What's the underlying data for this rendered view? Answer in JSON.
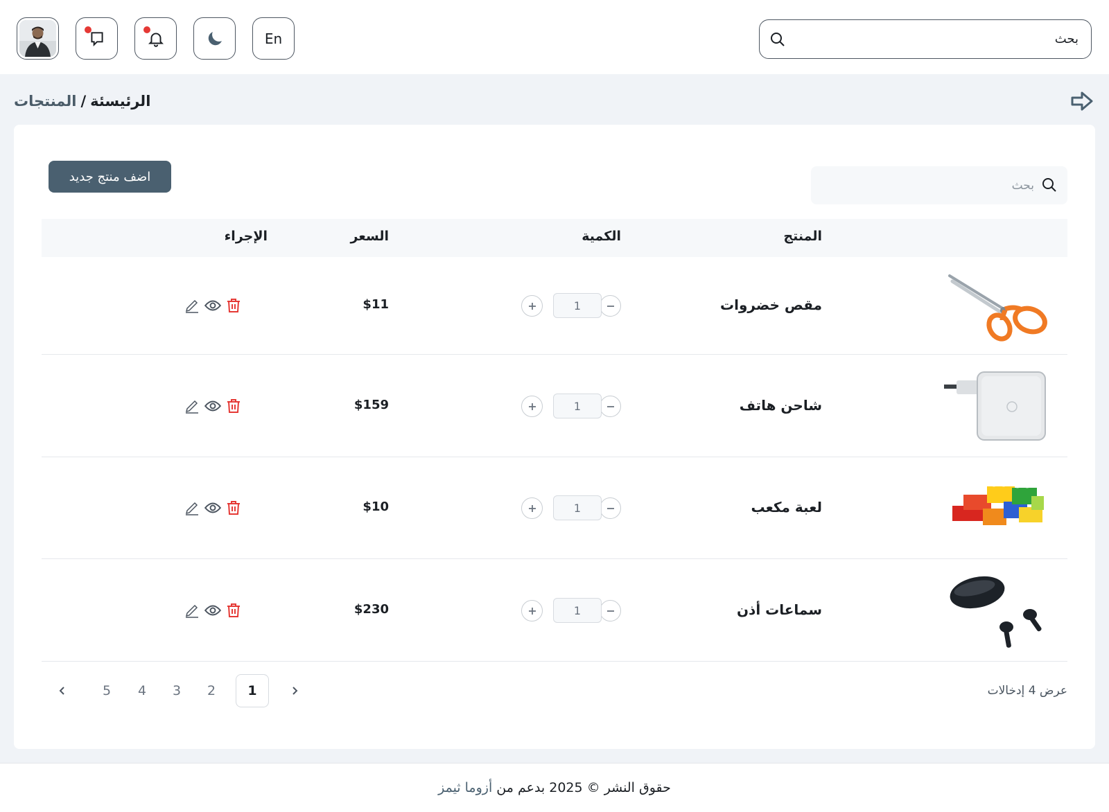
{
  "header": {
    "search_placeholder": "بحث",
    "language_label": "En",
    "icons": [
      "search-icon",
      "moon-icon",
      "bell-icon",
      "message-icon",
      "avatar"
    ]
  },
  "breadcrumb": {
    "home": "الرئيسئة",
    "separator": "/",
    "current": "المنتجات"
  },
  "toolbar": {
    "add_button_label": "اضف منتج جديد",
    "search_placeholder": "بحث"
  },
  "table": {
    "columns": {
      "product": "المنتج",
      "quantity": "الكمية",
      "price": "السعر",
      "action": "الإجراء"
    },
    "rows": [
      {
        "name": "مقص خضروات",
        "quantity": "1",
        "price": "$11",
        "image": "scissors"
      },
      {
        "name": "شاحن هاتف",
        "quantity": "1",
        "price": "$159",
        "image": "charger"
      },
      {
        "name": "لعبة مكعب",
        "quantity": "1",
        "price": "$10",
        "image": "blocks"
      },
      {
        "name": "سماعات أذن",
        "quantity": "1",
        "price": "$230",
        "image": "earbuds"
      }
    ]
  },
  "pagination": {
    "info": "عرض 4 إدخالات",
    "pages": [
      "1",
      "2",
      "3",
      "4",
      "5"
    ],
    "active_page": "1"
  },
  "footer": {
    "text": "حقوق النشر © 2025 بدعم من",
    "link": "أزوما ثيمز"
  },
  "colors": {
    "primary": "#4a6070",
    "danger": "#e53935",
    "border": "#4c5560"
  }
}
